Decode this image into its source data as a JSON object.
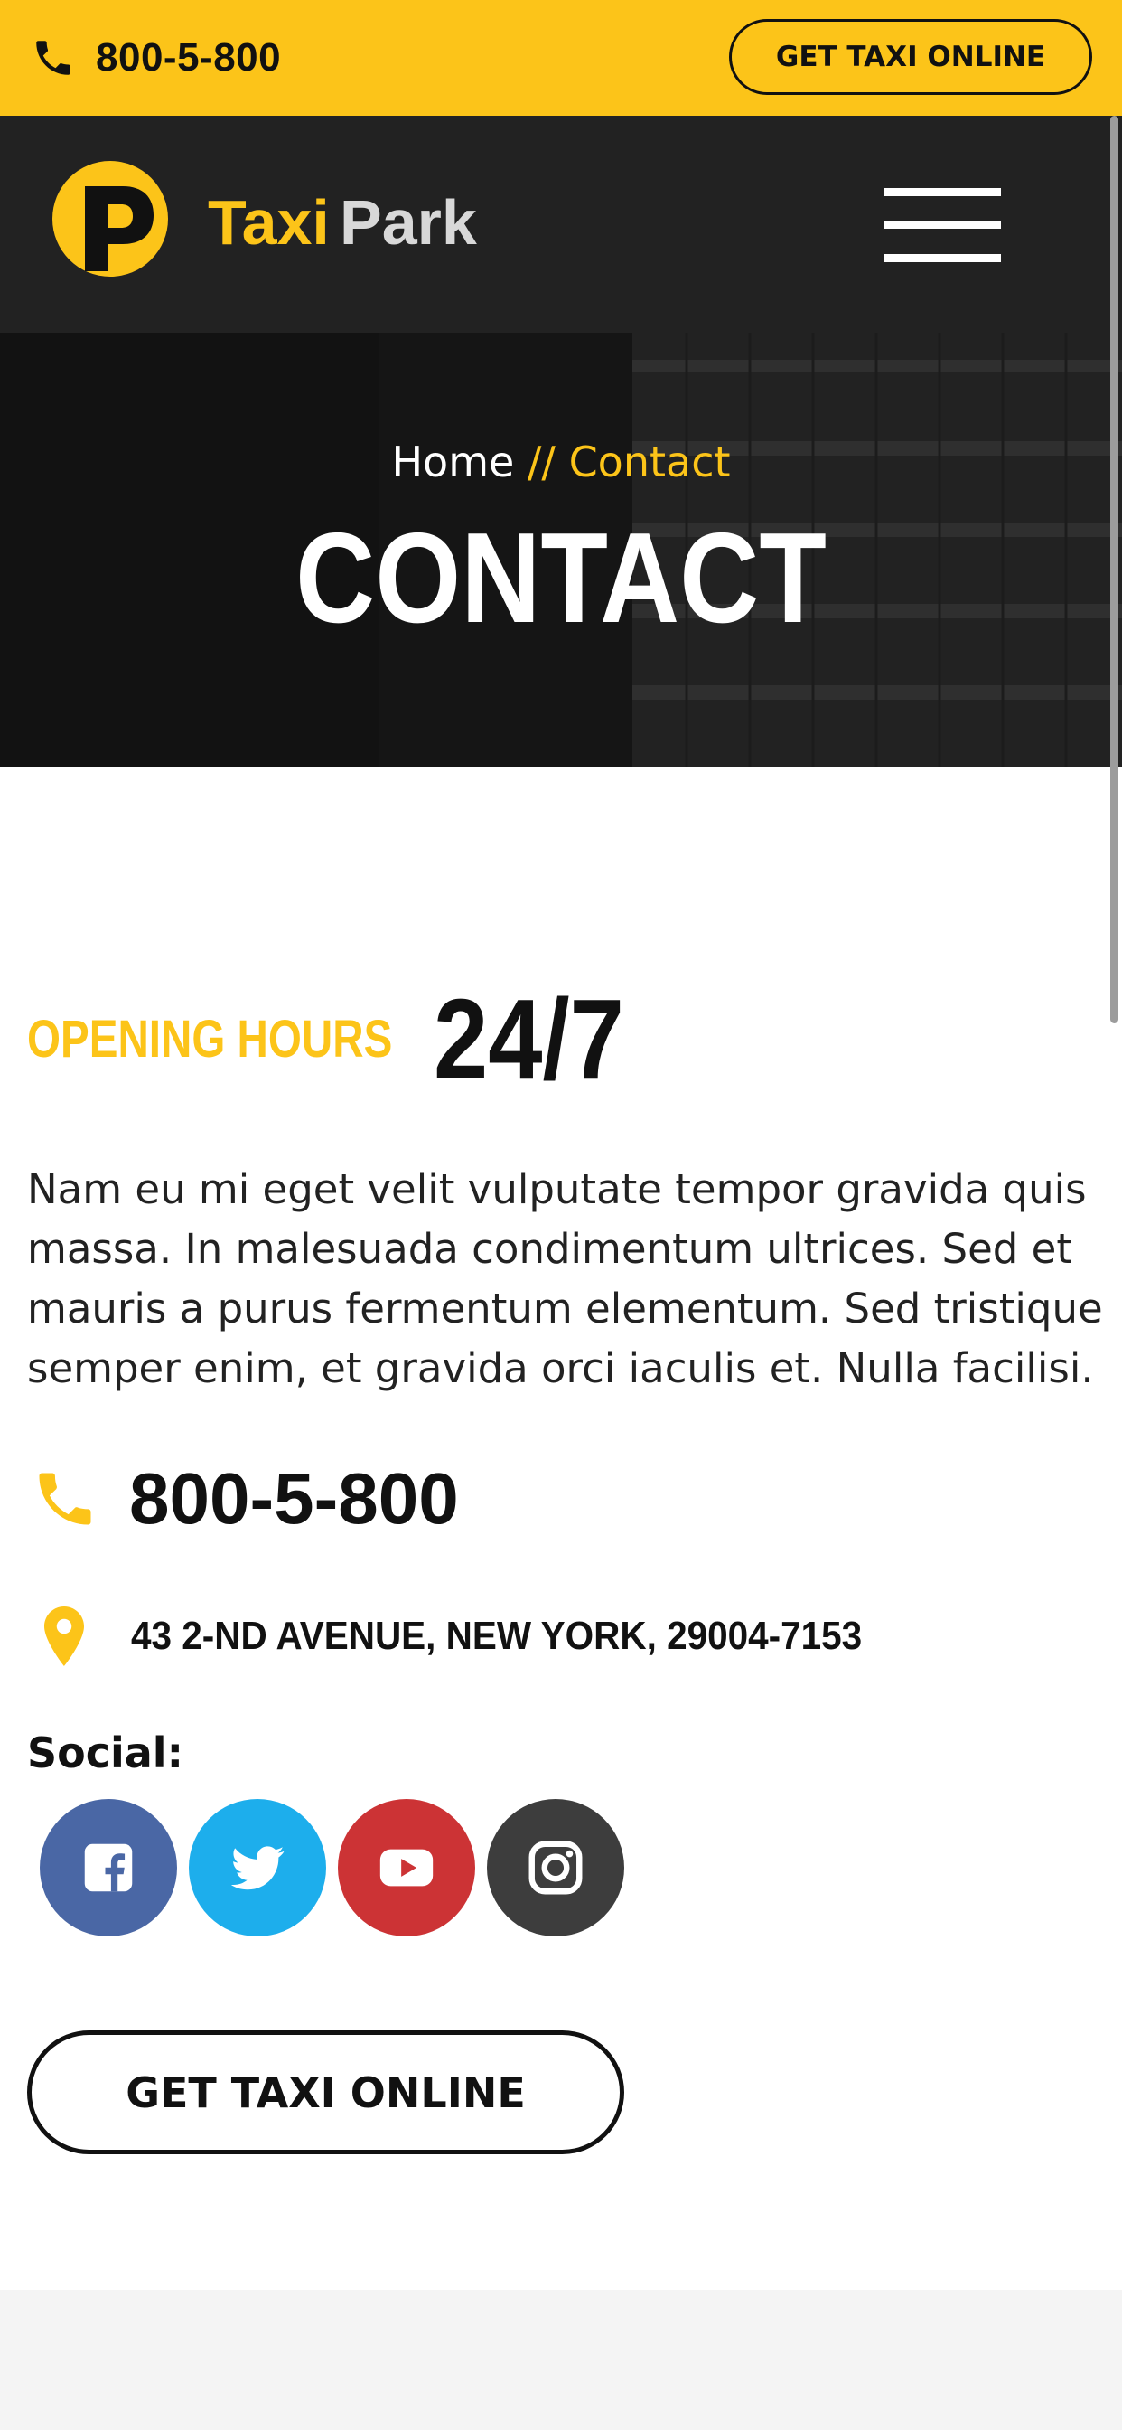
{
  "topbar": {
    "phone": "800-5-800",
    "cta_label": "GET TAXI ONLINE",
    "phone_icon": "phone-icon"
  },
  "header": {
    "logo_text_1": "Taxi",
    "logo_text_2": "Park",
    "logo_letter": "P",
    "menu_icon": "hamburger-menu-icon"
  },
  "hero": {
    "breadcrumb_home": "Home",
    "breadcrumb_sep": " // ",
    "breadcrumb_current": "Contact",
    "title": "CONTACT"
  },
  "main": {
    "hours_label": "OPENING HOURS",
    "hours_value": "24/7",
    "intro": "Nam eu mi eget velit vulputate tempor gravida quis massa. In malesuada condimentum ultrices. Sed et mauris a purus fermentum elementum. Sed tristique semper enim, et gravida orci iaculis et. Nulla facilisi.",
    "phone": "800-5-800",
    "address": "43 2-ND AVENUE, NEW YORK, 29004-7153",
    "social_label": "Social:",
    "social": [
      {
        "name": "facebook",
        "icon": "facebook-icon",
        "color": "#4a67a5"
      },
      {
        "name": "twitter",
        "icon": "twitter-icon",
        "color": "#1daeec"
      },
      {
        "name": "youtube",
        "icon": "youtube-icon",
        "color": "#cc3335"
      },
      {
        "name": "instagram",
        "icon": "instagram-icon",
        "color": "#3d3d3d"
      }
    ],
    "cta_label": "GET TAXI ONLINE"
  },
  "colors": {
    "accent": "#fcc419",
    "header_bg": "#222222",
    "text": "#111111"
  }
}
